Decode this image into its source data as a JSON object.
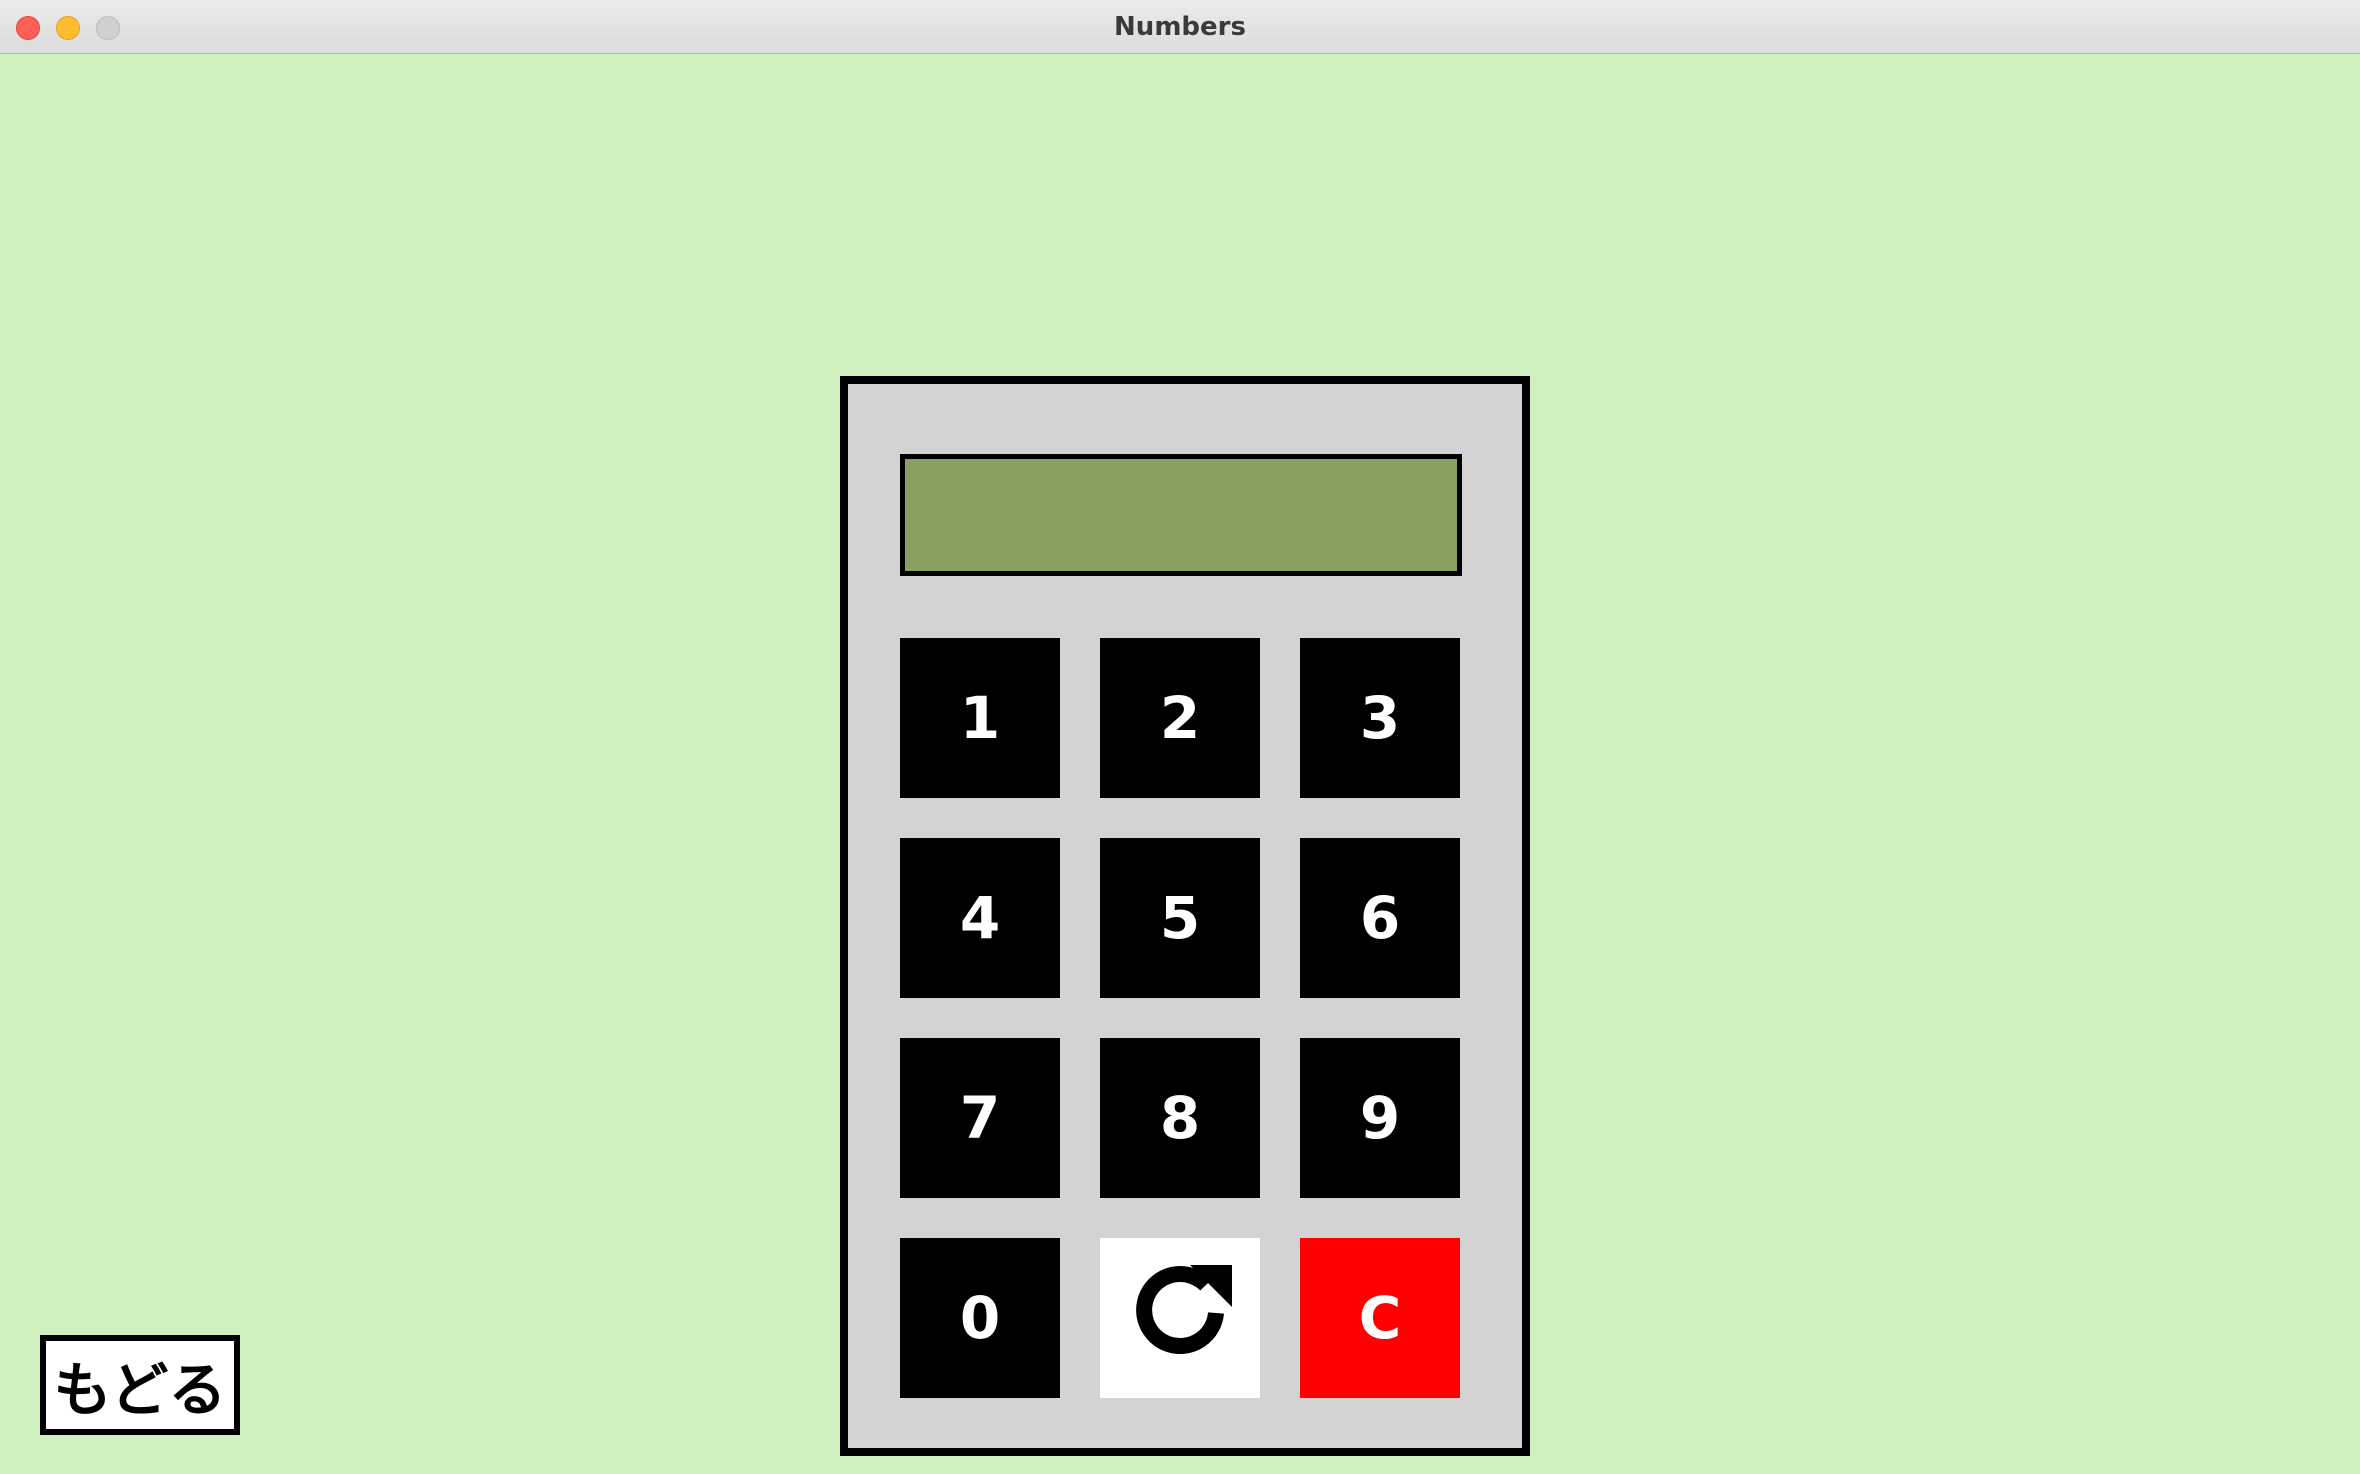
{
  "window": {
    "title": "Numbers"
  },
  "calculator": {
    "display_value": "",
    "keys": {
      "k1": "1",
      "k2": "2",
      "k3": "3",
      "k4": "4",
      "k5": "5",
      "k6": "6",
      "k7": "7",
      "k8": "8",
      "k9": "9",
      "k0": "0",
      "refresh_icon": "refresh-icon",
      "clear": "C"
    }
  },
  "back_button": {
    "label": "もどる"
  },
  "colors": {
    "background": "#d0f0c0",
    "calculator_body": "#d3d3d3",
    "display": "#89a160",
    "key": "#000000",
    "refresh_key": "#ffffff",
    "clear_key": "#ff0000"
  }
}
